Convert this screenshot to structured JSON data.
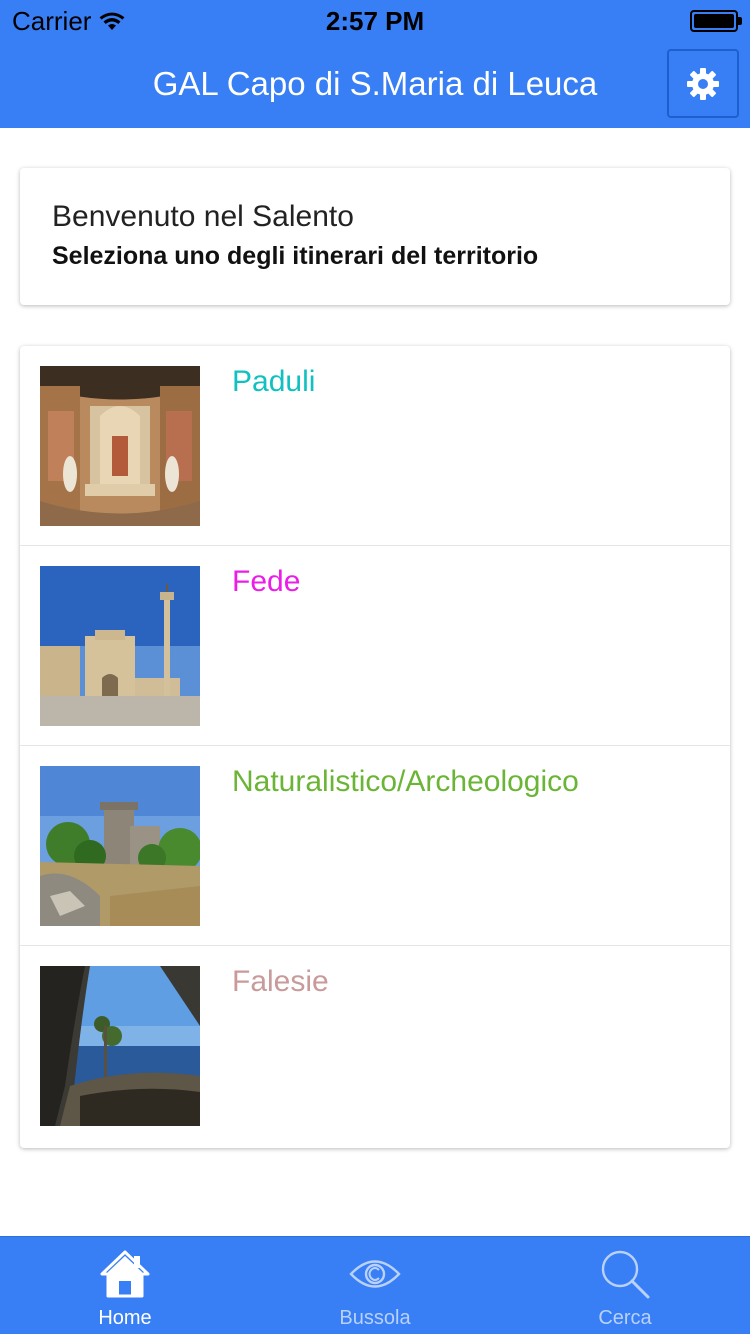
{
  "status_bar": {
    "carrier": "Carrier",
    "time": "2:57 PM"
  },
  "header": {
    "title": "GAL Capo di S.Maria di Leuca",
    "settings_icon": "gear-icon",
    "background_color": "#387ef5"
  },
  "welcome": {
    "title": "Benvenuto nel Salento",
    "subtitle": "Seleziona uno degli itinerari del territorio"
  },
  "itineraries": [
    {
      "label": "Paduli",
      "color": "#11c1c1",
      "image": "chapel-frescoes-photo"
    },
    {
      "label": "Fede",
      "color": "#ea1ee6",
      "image": "basilica-column-photo"
    },
    {
      "label": "Naturalistico/Archeologico",
      "color": "#6ab535",
      "image": "tower-ruins-photo"
    },
    {
      "label": "Falesie",
      "color": "#c99a9a",
      "image": "sea-cliffs-photo"
    }
  ],
  "tabbar": {
    "tabs": [
      {
        "label": "Home",
        "icon": "home-icon",
        "active": true
      },
      {
        "label": "Bussola",
        "icon": "eye-icon",
        "active": false
      },
      {
        "label": "Cerca",
        "icon": "search-icon",
        "active": false
      }
    ]
  }
}
